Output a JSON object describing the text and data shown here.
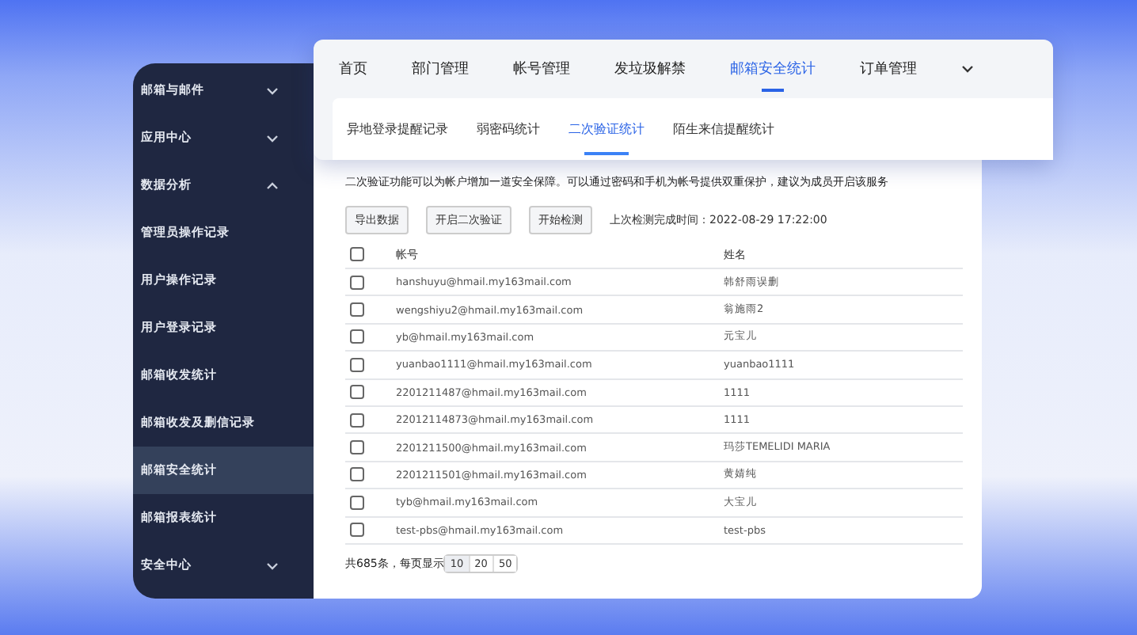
{
  "sidebar": {
    "items": [
      {
        "label": "邮箱与邮件",
        "kind": "group",
        "expanded": false,
        "selected": false
      },
      {
        "label": "应用中心",
        "kind": "group",
        "expanded": false,
        "selected": false
      },
      {
        "label": "数据分析",
        "kind": "group",
        "expanded": true,
        "selected": false
      },
      {
        "label": "管理员操作记录",
        "kind": "link",
        "selected": false
      },
      {
        "label": "用户操作记录",
        "kind": "link",
        "selected": false
      },
      {
        "label": "用户登录记录",
        "kind": "link",
        "selected": false
      },
      {
        "label": "邮箱收发统计",
        "kind": "link",
        "selected": false
      },
      {
        "label": "邮箱收发及删信记录",
        "kind": "link",
        "selected": false
      },
      {
        "label": "邮箱安全统计",
        "kind": "link",
        "selected": true
      },
      {
        "label": "邮箱报表统计",
        "kind": "link",
        "selected": false
      },
      {
        "label": "安全中心",
        "kind": "group",
        "expanded": false,
        "selected": false
      }
    ]
  },
  "nav": {
    "tabs": [
      {
        "label": "首页",
        "selected": false
      },
      {
        "label": "部门管理",
        "selected": false
      },
      {
        "label": "帐号管理",
        "selected": false
      },
      {
        "label": "发垃圾解禁",
        "selected": false
      },
      {
        "label": "邮箱安全统计",
        "selected": true
      },
      {
        "label": "订单管理",
        "selected": false
      }
    ]
  },
  "subtabs": [
    {
      "label": "异地登录提醒记录",
      "selected": false
    },
    {
      "label": "弱密码统计",
      "selected": false
    },
    {
      "label": "二次验证统计",
      "selected": true
    },
    {
      "label": "陌生来信提醒统计",
      "selected": false
    }
  ],
  "description": "二次验证功能可以为帐户增加一道安全保障。可以通过密码和手机为帐号提供双重保护，建议为成员开启该服务",
  "toolbar": {
    "buttons": [
      "导出数据",
      "开启二次验证",
      "开始检测"
    ],
    "last_check": "上次检测完成时间：2022-08-29 17:22:00"
  },
  "table": {
    "header_checked": false,
    "columns": [
      "帐号",
      "姓名"
    ],
    "rows": [
      {
        "account": "hanshuyu@hmail.my163mail.com",
        "name": "韩舒雨误删",
        "checked": false
      },
      {
        "account": "wengshiyu2@hmail.my163mail.com",
        "name": "翁施雨2",
        "checked": false
      },
      {
        "account": "yb@hmail.my163mail.com",
        "name": "元宝儿",
        "checked": false
      },
      {
        "account": "yuanbao1111@hmail.my163mail.com",
        "name": "yuanbao1111",
        "checked": false
      },
      {
        "account": "2201211487@hmail.my163mail.com",
        "name": "1111",
        "checked": false
      },
      {
        "account": "22012114873@hmail.my163mail.com",
        "name": "1111",
        "checked": false
      },
      {
        "account": "2201211500@hmail.my163mail.com",
        "name": "玛莎TEMELIDI MARIA",
        "checked": false
      },
      {
        "account": "2201211501@hmail.my163mail.com",
        "name": "黄婧纯",
        "checked": false
      },
      {
        "account": "tyb@hmail.my163mail.com",
        "name": "大宝儿",
        "checked": false
      },
      {
        "account": "test-pbs@hmail.my163mail.com",
        "name": "test-pbs",
        "checked": false
      }
    ]
  },
  "pagination": {
    "total": "共685条，每页显示",
    "sizes": [
      {
        "label": "10",
        "selected": true
      },
      {
        "label": "20",
        "selected": false
      },
      {
        "label": "50",
        "selected": false
      }
    ]
  }
}
